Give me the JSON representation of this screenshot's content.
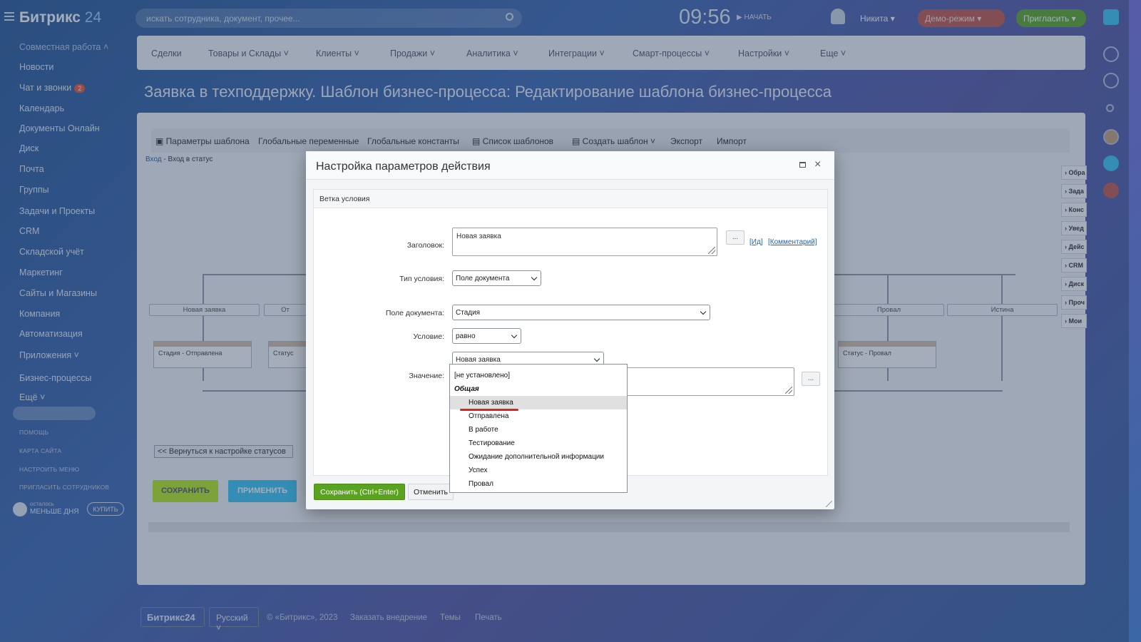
{
  "app": {
    "logo_main": "Битрикс",
    "logo_num": "24"
  },
  "topbar": {
    "search_placeholder": "искать сотрудника, документ, прочее...",
    "clock": "09:56",
    "start_label": "НАЧАТЬ",
    "user_name": "Никита",
    "demo_label": "Демо-режим",
    "invite_label": "Пригласить"
  },
  "sidebar": {
    "group_label": "Совместная работа",
    "items": [
      "Новости",
      "Чат и звонки",
      "Календарь",
      "Документы Онлайн",
      "Диск",
      "Почта",
      "Группы",
      "Задачи и Проекты",
      "CRM",
      "Складской учёт",
      "Маркетинг",
      "Сайты и Магазины",
      "Компания",
      "Автоматизация",
      "Приложения",
      "Бизнес-процессы",
      "Ещё"
    ],
    "chat_badge": "2",
    "small_links": [
      "ПОМОЩЬ",
      "КАРТА САЙТА",
      "НАСТРОИТЬ МЕНЮ",
      "ПРИГЛАСИТЬ СОТРУДНИКОВ"
    ],
    "trial_top": "осталось",
    "trial_bottom": "МЕНЬШЕ ДНЯ",
    "buy_label": "КУПИТЬ"
  },
  "nav": {
    "items": [
      "Сделки",
      "Товары и Склады",
      "Клиенты",
      "Продажи",
      "Аналитика",
      "Интеграции",
      "Смарт-процессы",
      "Настройки",
      "Еще"
    ]
  },
  "page": {
    "title": "Заявка в техподдержку. Шаблон бизнес-процесса: Редактирование шаблона бизнес-процесса"
  },
  "toolbar": {
    "items": [
      "Параметры шаблона",
      "Глобальные переменные",
      "Глобальные константы",
      "Список шаблонов",
      "Создать шаблон",
      "Экспорт",
      "Импорт"
    ]
  },
  "breadcrumb": {
    "link": "Вход",
    "sep": " - ",
    "current": "Вход в статус"
  },
  "workflow": {
    "branches": [
      "Новая заявка",
      "От",
      "Провал",
      "Истина"
    ],
    "actions": [
      "Стадия - Отправлена",
      "Статус",
      "Статус - Провал"
    ],
    "back_button": "<< Вернуться к настройке статусов",
    "save_button": "СОХРАНИТЬ",
    "apply_button": "ПРИМЕНИТЬ"
  },
  "right_panel": [
    "Обра",
    "Зада",
    "Конс",
    "Увед",
    "Дейс",
    "CRM",
    "Диск",
    "Проч",
    "Мои"
  ],
  "footer": {
    "logo": "Битрикс24",
    "lang": "Русский",
    "copyright": "© «Битрикс», 2023",
    "order": "Заказать внедрение",
    "themes": "Темы",
    "print": "Печать"
  },
  "modal": {
    "title": "Настройка параметров действия",
    "section": "Ветка условия",
    "title_label": "Заголовок:",
    "title_value": "Новая заявка",
    "dots": "...",
    "link_id": "[Ид]",
    "link_comment": "[Комментарий]",
    "cond_type_label": "Тип условия:",
    "cond_type_value": "Поле документа",
    "doc_field_label": "Поле документа:",
    "doc_field_value": "Стадия",
    "condition_label": "Условие:",
    "condition_value": "равно",
    "value_label": "Значение:",
    "value_select": "Новая заявка",
    "save_button": "Сохранить (Ctrl+Enter)",
    "cancel_button": "Отменить"
  },
  "dropdown": {
    "none": "[не установлено]",
    "group": "Общая",
    "options": [
      "Новая заявка",
      "Отправлена",
      "В работе",
      "Тестирование",
      "Ожидание дополнительной информации",
      "Успех",
      "Провал"
    ],
    "highlighted_index": 0
  },
  "colors": {
    "accent_green": "#5aa320",
    "link": "#2067b0",
    "underline": "#e2231a"
  }
}
